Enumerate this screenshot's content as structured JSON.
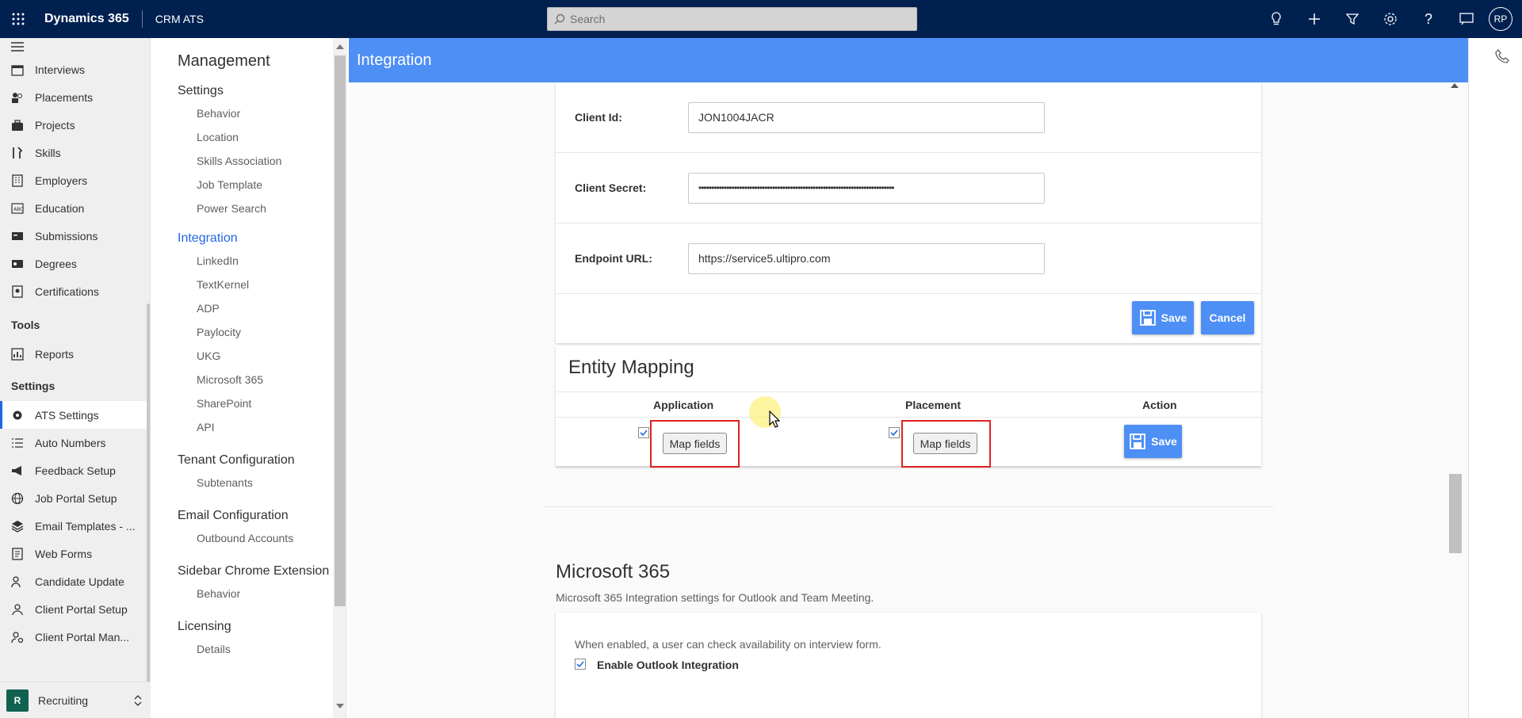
{
  "topbar": {
    "app_name": "Dynamics 365",
    "app_sub": "CRM ATS",
    "search_placeholder": "Search",
    "avatar": "RP"
  },
  "leftnav": {
    "items_top": [
      {
        "label": "Interviews",
        "icon": "calendar-icon"
      },
      {
        "label": "Placements",
        "icon": "people-icon"
      },
      {
        "label": "Projects",
        "icon": "briefcase-icon"
      },
      {
        "label": "Skills",
        "icon": "tools-icon"
      },
      {
        "label": "Employers",
        "icon": "building-icon"
      },
      {
        "label": "Education",
        "icon": "abc-icon"
      },
      {
        "label": "Submissions",
        "icon": "card-icon"
      },
      {
        "label": "Degrees",
        "icon": "id-card-icon"
      },
      {
        "label": "Certifications",
        "icon": "certificate-icon"
      }
    ],
    "tools_header": "Tools",
    "tools_items": [
      {
        "label": "Reports",
        "icon": "report-icon"
      }
    ],
    "settings_header": "Settings",
    "settings_items": [
      {
        "label": "ATS Settings",
        "icon": "gear-icon"
      },
      {
        "label": "Auto Numbers",
        "icon": "list-icon"
      },
      {
        "label": "Feedback Setup",
        "icon": "megaphone-icon"
      },
      {
        "label": "Job Portal Setup",
        "icon": "globe-icon"
      },
      {
        "label": "Email Templates - ...",
        "icon": "layers-icon"
      },
      {
        "label": "Web Forms",
        "icon": "form-icon"
      },
      {
        "label": "Candidate Update",
        "icon": "refresh-icon"
      },
      {
        "label": "Client Portal Setup",
        "icon": "person-icon"
      },
      {
        "label": "Client Portal Man...",
        "icon": "person-settings-icon"
      }
    ],
    "area": {
      "badge": "R",
      "label": "Recruiting"
    }
  },
  "panel": {
    "title": "Management",
    "sections": [
      {
        "label": "Settings",
        "items": [
          "Behavior",
          "Location",
          "Skills Association",
          "Job Template",
          "Power Search"
        ]
      },
      {
        "label": "Integration",
        "items": [
          "LinkedIn",
          "TextKernel",
          "ADP",
          "Paylocity",
          "UKG",
          "Microsoft 365",
          "SharePoint",
          "API"
        ]
      },
      {
        "label": "Tenant Configuration",
        "items": [
          "Subtenants"
        ]
      },
      {
        "label": "Email Configuration",
        "items": [
          "Outbound Accounts"
        ]
      },
      {
        "label": "Sidebar Chrome Extension",
        "items": [
          "Behavior"
        ]
      },
      {
        "label": "Licensing",
        "items": [
          "Details"
        ]
      }
    ]
  },
  "main": {
    "header": "Integration",
    "form": {
      "client_id_label": "Client Id:",
      "client_id_value": "JON1004JACR",
      "client_secret_label": "Client Secret:",
      "client_secret_value": "•••••••••••••••••••••••••••••••••••••••••••••••••••••••••••••••••••••••••••••",
      "endpoint_label": "Endpoint URL:",
      "endpoint_value": "https://service5.ultipro.com",
      "save": "Save",
      "cancel": "Cancel"
    },
    "entity_mapping": {
      "title": "Entity Mapping",
      "col_application": "Application",
      "col_placement": "Placement",
      "col_action": "Action",
      "map_fields": "Map fields",
      "save": "Save"
    },
    "microsoft365": {
      "title": "Microsoft 365",
      "subtitle": "Microsoft 365 Integration settings for Outlook and Team Meeting.",
      "note": "When enabled, a user can check availability on interview form.",
      "checkbox_label": "Enable Outlook Integration"
    }
  },
  "colors": {
    "topbar": "#002050",
    "accent": "#4d8ff5",
    "active": "#2266e3",
    "highlight": "#e02020"
  }
}
